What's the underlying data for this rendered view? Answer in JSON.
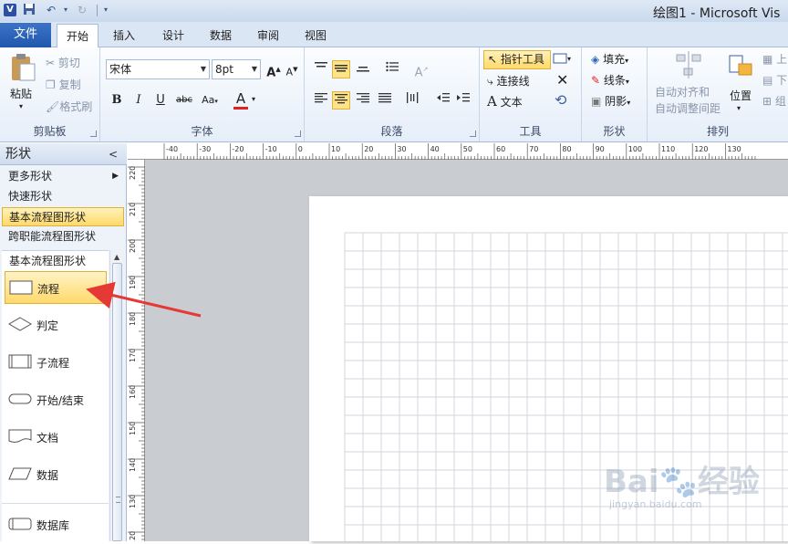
{
  "window": {
    "title": "绘图1 - Microsoft Vis"
  },
  "quick_access": {
    "save_icon": "save-icon",
    "undo_icon": "undo-icon",
    "redo_icon": "redo-icon"
  },
  "tabs": {
    "file": "文件",
    "home": "开始",
    "insert": "插入",
    "design": "设计",
    "data": "数据",
    "review": "审阅",
    "view": "视图"
  },
  "ribbon": {
    "clipboard": {
      "label": "剪贴板",
      "paste": "粘贴",
      "cut": "剪切",
      "copy": "复制",
      "format_painter": "格式刷"
    },
    "font": {
      "label": "字体",
      "font_name": "宋体",
      "font_size": "8pt",
      "bold": "B",
      "italic": "I",
      "underline": "U",
      "strike": "abc",
      "case": "Aa",
      "color": "A"
    },
    "paragraph": {
      "label": "段落"
    },
    "tools": {
      "label": "工具",
      "pointer": "指针工具",
      "connector": "连接线",
      "text": "文本"
    },
    "shape": {
      "label": "形状",
      "fill": "填充",
      "line": "线条",
      "shadow": "阴影"
    },
    "arrange": {
      "label": "排列",
      "auto_align": "自动对齐和",
      "auto_adjust": "自动调整间距",
      "position": "位置",
      "up": "上",
      "down": "下",
      "group": "组"
    }
  },
  "shapes_panel": {
    "title": "形状",
    "items": [
      {
        "label": "更多形状",
        "has_arrow": true
      },
      {
        "label": "快速形状"
      },
      {
        "label": "基本流程图形状",
        "selected": true
      },
      {
        "label": "跨职能流程图形状"
      }
    ],
    "stencil_title": "基本流程图形状",
    "shapes": [
      {
        "label": "流程",
        "icon": "process-shape-icon",
        "selected": true
      },
      {
        "label": "判定",
        "icon": "decision-shape-icon"
      },
      {
        "label": "子流程",
        "icon": "subprocess-shape-icon"
      },
      {
        "label": "开始/结束",
        "icon": "terminator-shape-icon"
      },
      {
        "label": "文档",
        "icon": "document-shape-icon"
      },
      {
        "label": "数据",
        "icon": "data-shape-icon"
      },
      {
        "label": "数据库",
        "icon": "database-shape-icon"
      }
    ]
  },
  "ruler": {
    "h_ticks": [
      "-40",
      "-30",
      "-20",
      "-10",
      "0",
      "10",
      "20",
      "30",
      "40",
      "50",
      "60",
      "70",
      "80",
      "90",
      "100",
      "110",
      "120",
      "130"
    ],
    "v_ticks": [
      "220",
      "210",
      "200",
      "190",
      "180",
      "170",
      "160",
      "150",
      "140",
      "130",
      "120"
    ]
  },
  "colors": {
    "accent": "#ffd96b",
    "file_tab": "#2a63b8",
    "arrow": "#e53935"
  }
}
